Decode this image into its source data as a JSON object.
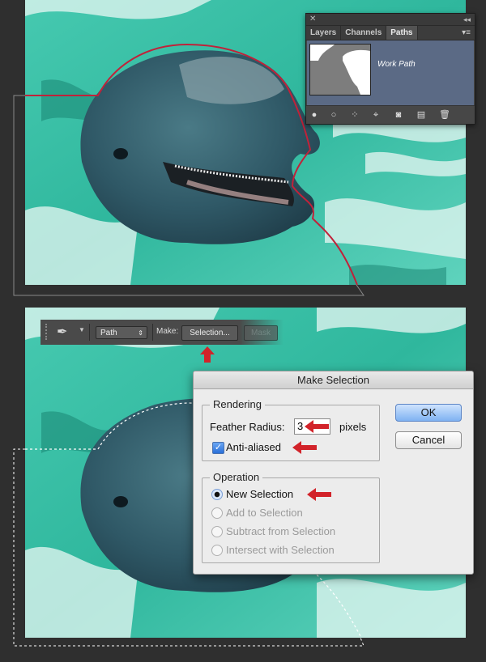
{
  "paths_panel": {
    "tabs": [
      {
        "label": "Layers",
        "active": false
      },
      {
        "label": "Channels",
        "active": false
      },
      {
        "label": "Paths",
        "active": true
      }
    ],
    "work_path_label": "Work Path",
    "bottom_icons": [
      "fill-path-icon",
      "stroke-path-icon",
      "load-as-selection-icon",
      "make-work-path-icon",
      "add-mask-icon",
      "new-path-icon",
      "trash-icon"
    ]
  },
  "options_bar": {
    "tool_icon": "pen-tool-icon",
    "mode": "Path",
    "make_label": "Make:",
    "selection_button": "Selection...",
    "mask_button": "Mask"
  },
  "make_selection_dialog": {
    "title": "Make Selection",
    "rendering_legend": "Rendering",
    "feather_label": "Feather Radius:",
    "feather_value": "3",
    "feather_unit": "pixels",
    "antialias_label": "Anti-aliased",
    "antialias_checked": true,
    "operation_legend": "Operation",
    "operations": [
      {
        "label": "New Selection",
        "selected": true,
        "enabled": true
      },
      {
        "label": "Add to Selection",
        "selected": false,
        "enabled": false
      },
      {
        "label": "Subtract from Selection",
        "selected": false,
        "enabled": false
      },
      {
        "label": "Intersect with Selection",
        "selected": false,
        "enabled": false
      }
    ],
    "ok_label": "OK",
    "cancel_label": "Cancel"
  },
  "colors": {
    "water": "#3bbfa6",
    "path_red": "#c0223a",
    "arrow_red": "#d2232a",
    "panel_row_selected": "#5b6a85"
  }
}
